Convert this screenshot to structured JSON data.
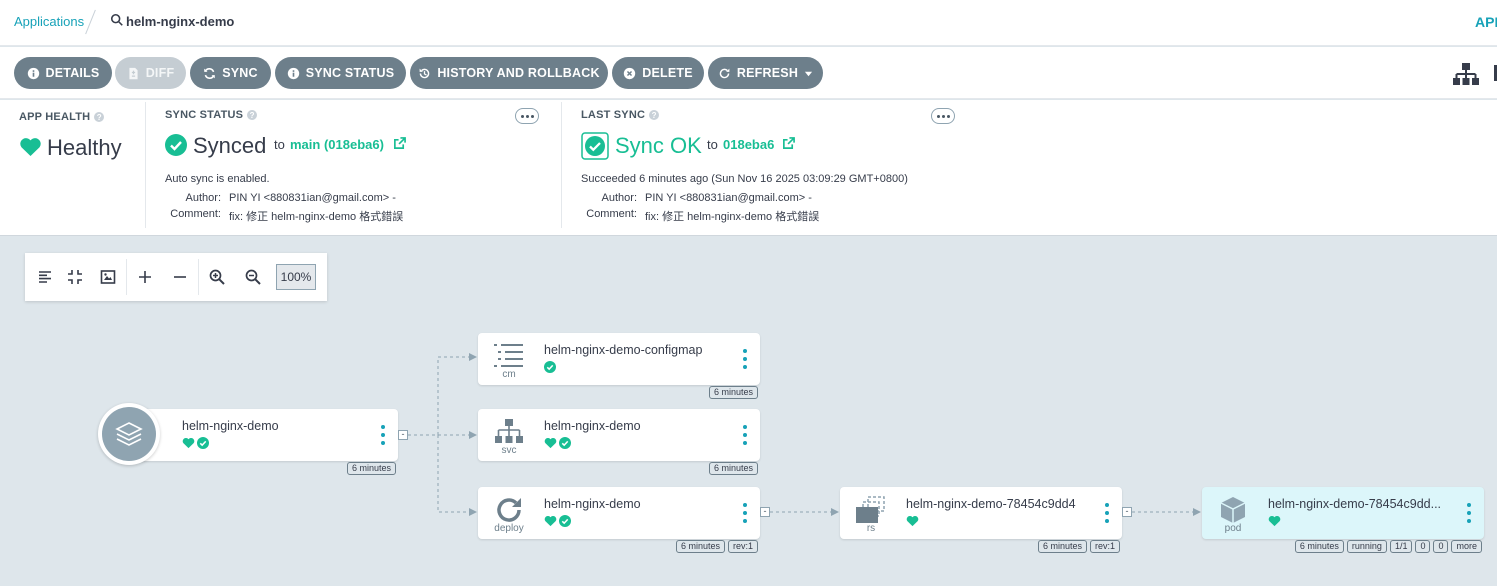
{
  "breadcrumb": {
    "applications": "Applications",
    "app_name": "helm-nginx-demo",
    "right_label": "APP"
  },
  "toolbar": {
    "details": "DETAILS",
    "diff": "DIFF",
    "sync": "SYNC",
    "sync_status": "SYNC STATUS",
    "history": "HISTORY AND ROLLBACK",
    "delete": "DELETE",
    "refresh": "REFRESH"
  },
  "app_health": {
    "label": "APP HEALTH",
    "value": "Healthy"
  },
  "sync_status": {
    "label": "SYNC STATUS",
    "value": "Synced",
    "to": "to",
    "revision": "main (018eba6)",
    "auto_sync": "Auto sync is enabled.",
    "author_label": "Author:",
    "author": "PIN YI <880831ian@gmail.com> -",
    "comment_label": "Comment:",
    "comment": "fix: 修正 helm-nginx-demo 格式錯誤"
  },
  "last_sync": {
    "label": "LAST SYNC",
    "value": "Sync OK",
    "to": "to",
    "revision": "018eba6",
    "succeeded": "Succeeded 6 minutes ago (Sun Nov 16 2025 03:09:29 GMT+0800)",
    "author_label": "Author:",
    "author": "PIN YI <880831ian@gmail.com> -",
    "comment_label": "Comment:",
    "comment": "fix: 修正 helm-nginx-demo 格式錯誤"
  },
  "zoom": {
    "level": "100%"
  },
  "colors": {
    "accent": "#17a2b8",
    "healthy": "#18be94",
    "button": "#6d7f8b"
  },
  "nodes": {
    "app": {
      "name": "helm-nginx-demo",
      "age": "6 minutes"
    },
    "configmap": {
      "name": "helm-nginx-demo-configmap",
      "kind": "cm",
      "age": "6 minutes"
    },
    "svc": {
      "name": "helm-nginx-demo",
      "kind": "svc",
      "age": "6 minutes"
    },
    "deploy": {
      "name": "helm-nginx-demo",
      "kind": "deploy",
      "age": "6 minutes",
      "rev": "rev:1"
    },
    "rs": {
      "name": "helm-nginx-demo-78454c9dd4",
      "kind": "rs",
      "age": "6 minutes",
      "rev": "rev:1"
    },
    "pod": {
      "name": "helm-nginx-demo-78454c9dd...",
      "kind": "pod",
      "age": "6 minutes",
      "state": "running",
      "ready": "1/1",
      "restarts": "0",
      "extra": "0",
      "more": "more"
    }
  }
}
